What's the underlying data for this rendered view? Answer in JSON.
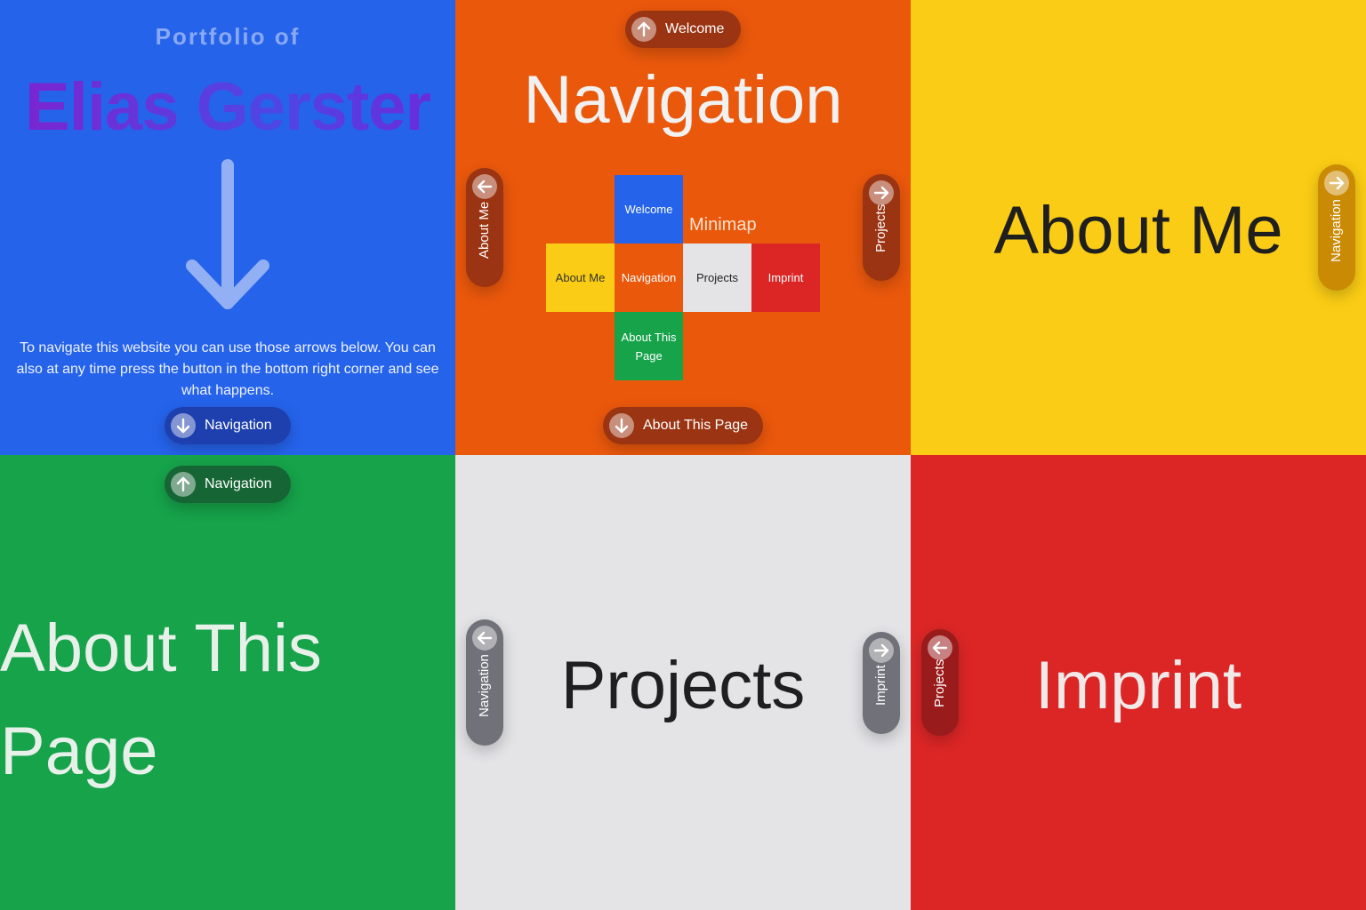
{
  "welcome": {
    "portfolio_of": "Portfolio of",
    "name": "Elias Gerster",
    "intro": "To navigate this website you can use those arrows below. You can also at any time press the button in the bottom right corner and see what happens.",
    "down_button": "Navigation",
    "icon": "arrow-down-icon"
  },
  "navigation": {
    "title": "Navigation",
    "up_button": "Welcome",
    "down_button": "About This Page",
    "left_button": "About Me",
    "right_button": "Projects",
    "minimap_label": "Minimap",
    "minimap": {
      "welcome": "Welcome",
      "about_me": "About Me",
      "navigation": "Navigation",
      "projects": "Projects",
      "imprint": "Imprint",
      "about_this_page": "About This Page"
    }
  },
  "about_me": {
    "title": "About Me",
    "right_button": "Navigation"
  },
  "about_this_page": {
    "title_line1": "About This",
    "title_line2": "Page",
    "up_button": "Navigation"
  },
  "projects": {
    "title": "Projects",
    "left_button": "Navigation",
    "right_button": "Imprint"
  },
  "imprint": {
    "title": "Imprint",
    "left_button": "Projects"
  },
  "colors": {
    "welcome": "#2563eb",
    "navigation": "#ea580c",
    "about_me": "#facc15",
    "about_this_page": "#16a34a",
    "projects": "#e4e4e7",
    "imprint": "#dc2626"
  }
}
